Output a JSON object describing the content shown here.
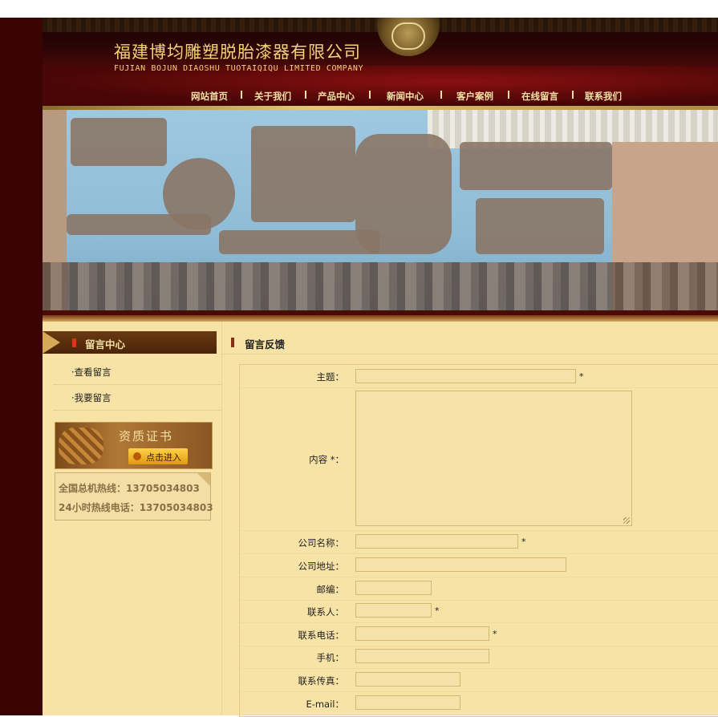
{
  "header": {
    "company_cn": "福建博均雕塑脱胎漆器有限公司",
    "company_en": "FUJIAN BOJUN DIAOSHU  TUOTAIQIQU  LIMITED COMPANY",
    "nav": [
      "网站首页",
      "关于我们",
      "产品中心",
      "新闻中心",
      "客户案例",
      "在线留言",
      "联系我们"
    ]
  },
  "sidebar": {
    "title": "留言中心",
    "links": [
      "·查看留言",
      "·我要留言"
    ],
    "cert_title": "资质证书",
    "cert_button": "点击进入",
    "hotlines": [
      "全国总机热线：13705034803",
      "24小时热线电话：13705034803"
    ]
  },
  "main": {
    "title": "留言反馈",
    "form": {
      "subject_label": "主题：",
      "content_label": "内容 *：",
      "company_label": "公司名称：",
      "address_label": "公司地址：",
      "zip_label": "邮编：",
      "contact_label": "联系人：",
      "phone_label": "联系电话：",
      "mobile_label": "手机：",
      "fax_label": "联系传真：",
      "email_label": "E-mail：",
      "required_mark": "*"
    }
  },
  "colors": {
    "page_background": "#f7e3a6",
    "header_red": "#5a0a0a",
    "nav_text": "#f3e0a6",
    "left_strip": "#3a0404"
  }
}
